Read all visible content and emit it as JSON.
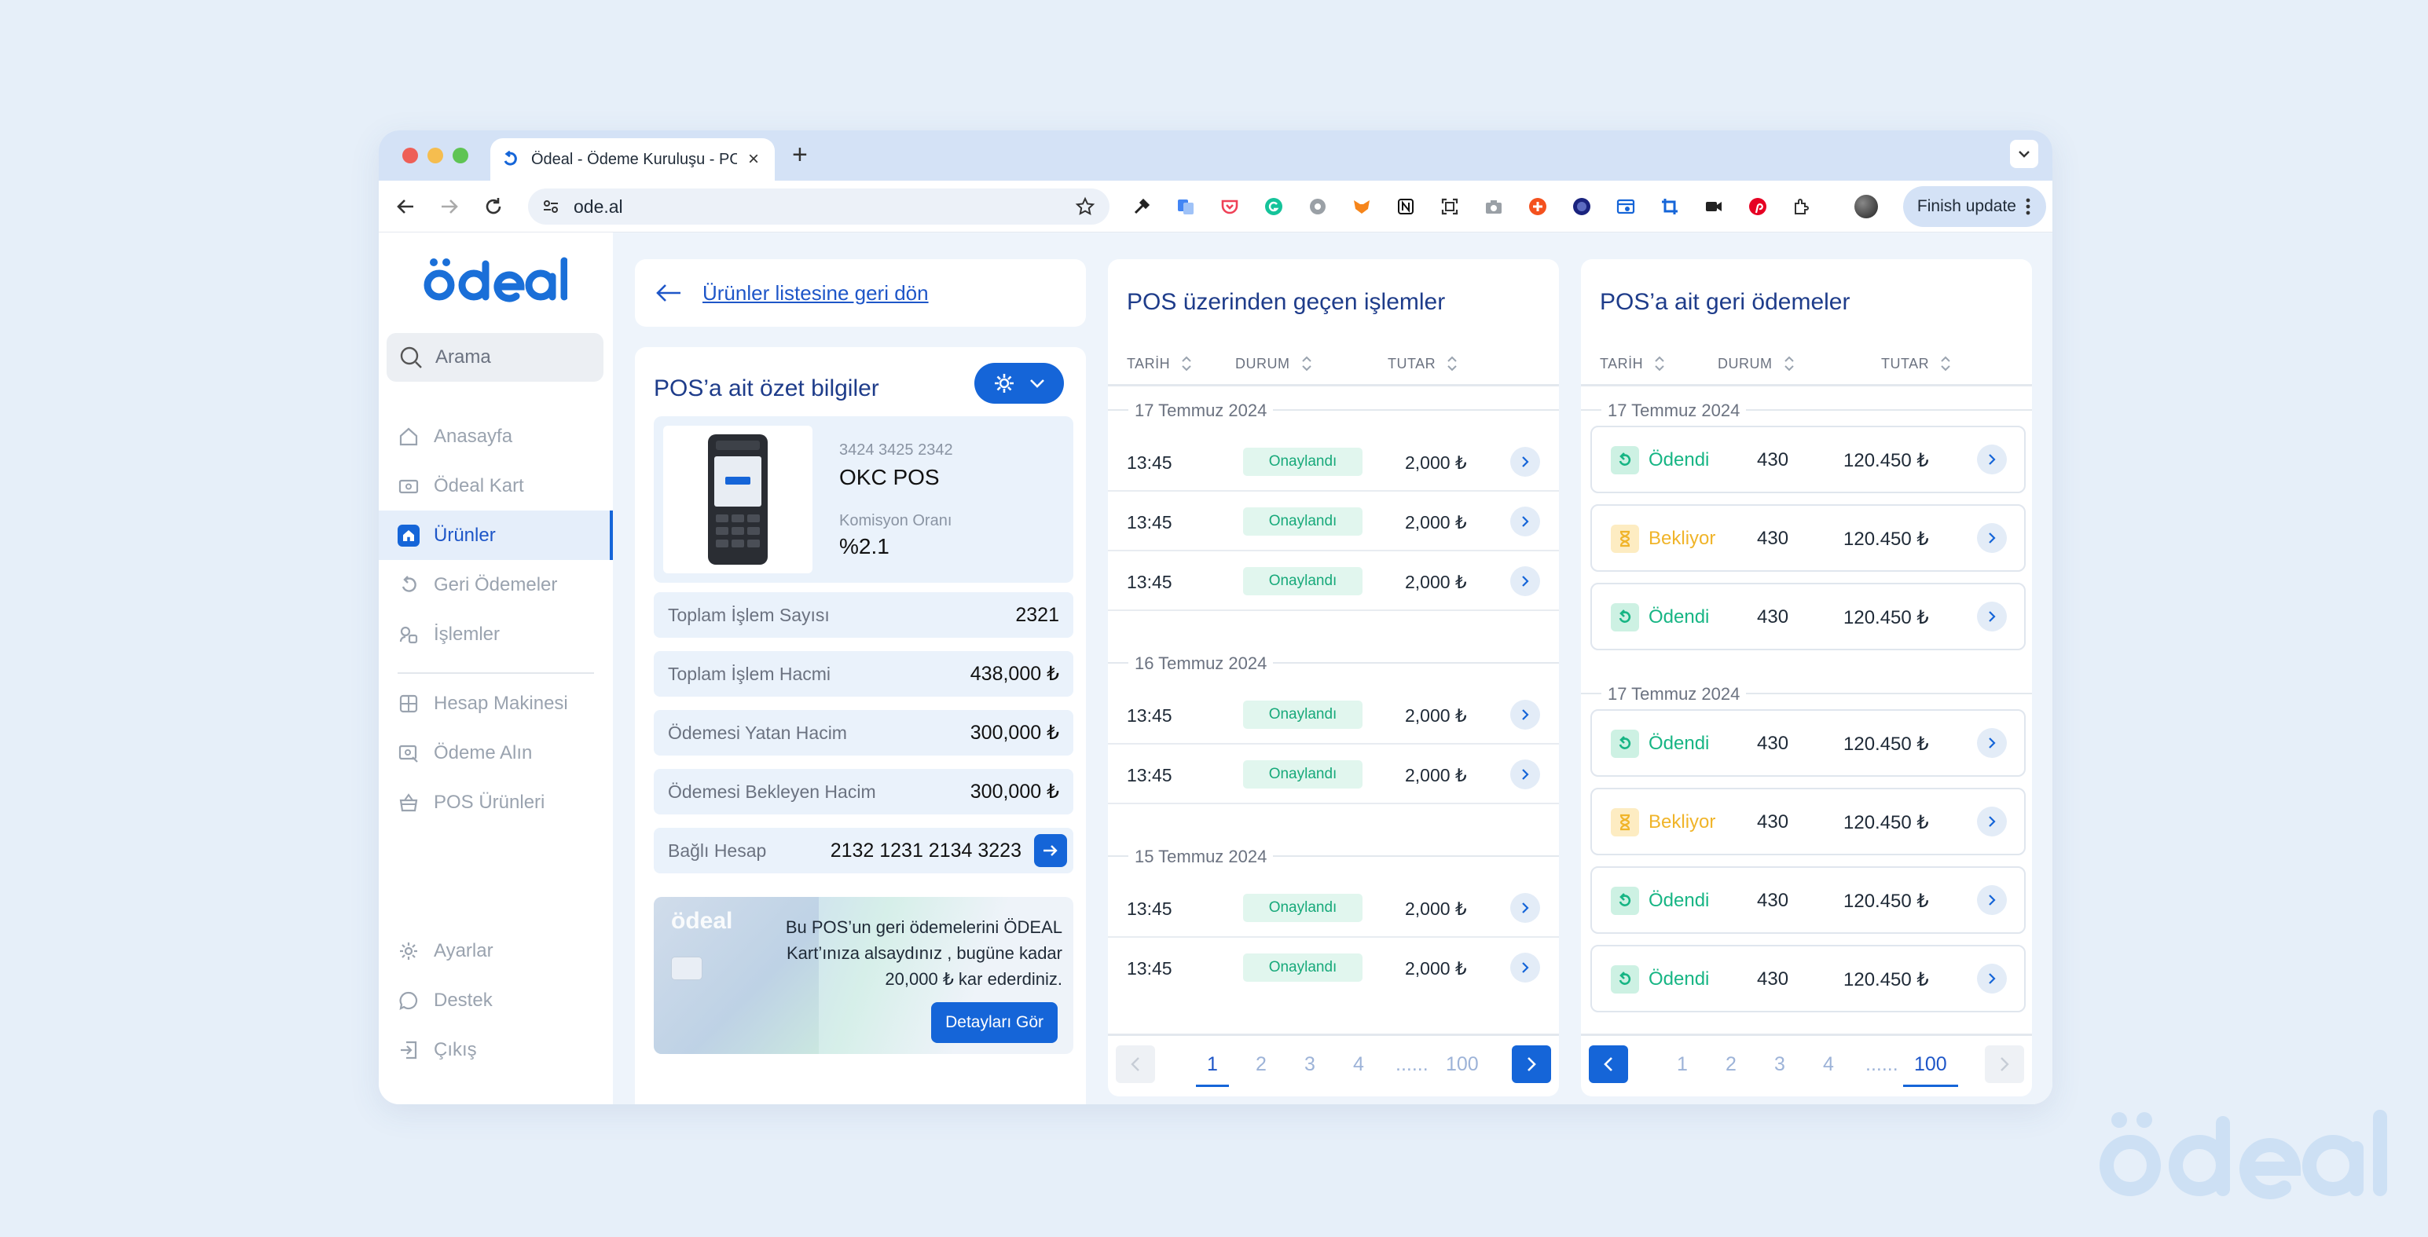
{
  "browser": {
    "tab_title": "Ödeal - Ödeme Kuruluşu - POS",
    "url": "ode.al",
    "finish_update": "Finish update"
  },
  "sidebar": {
    "search_placeholder": "Arama",
    "items": [
      {
        "label": "Anasayfa",
        "icon": "home-icon"
      },
      {
        "label": "Ödeal Kart",
        "icon": "card-icon"
      },
      {
        "label": "Ürünler",
        "icon": "home-filled-icon",
        "active": true
      },
      {
        "label": "Geri Ödemeler",
        "icon": "refund-icon"
      },
      {
        "label": "İşlemler",
        "icon": "transactions-icon"
      },
      {
        "label": "Hesap Makinesi",
        "icon": "calculator-icon"
      },
      {
        "label": "Ödeme Alın",
        "icon": "payment-icon"
      },
      {
        "label": "POS Ürünleri",
        "icon": "basket-icon"
      },
      {
        "label": "Ayarlar",
        "icon": "settings-icon"
      },
      {
        "label": "Destek",
        "icon": "chat-icon"
      },
      {
        "label": "Çıkış",
        "icon": "logout-icon"
      }
    ]
  },
  "back": {
    "label": "Ürünler listesine geri dön"
  },
  "summary": {
    "title": "POS’a ait özet bilgiler",
    "serial": "3424 3425 2342",
    "device_name": "OKC POS",
    "commission_label": "Komisyon Oranı",
    "commission_value": "%2.1",
    "rows": [
      {
        "label": "Toplam İşlem Sayısı",
        "value": "2321"
      },
      {
        "label": "Toplam İşlem Hacmi",
        "value": "438,000 ₺"
      },
      {
        "label": "Ödemesi Yatan Hacim",
        "value": "300,000 ₺"
      },
      {
        "label": "Ödemesi Bekleyen Hacim",
        "value": "300,000 ₺"
      }
    ],
    "linked_label": "Bağlı Hesap",
    "linked_value": "2132 1231 2134 3223",
    "promo_logo": "ödeal",
    "promo_text": "Bu POS’un geri ödemelerini ÖDEAL Kart’ınıza alsaydınız , bugüne kadar 20,000 ₺ kar ederdiniz.",
    "promo_button": "Detayları Gör"
  },
  "transactions": {
    "title": "POS üzerinden geçen işlemler",
    "headers": [
      "TARİH",
      "DURUM",
      "TUTAR"
    ],
    "groups": [
      {
        "date": "17 Temmuz 2024",
        "rows": [
          {
            "time": "13:45",
            "status": "Onaylandı",
            "amount": "2,000 ₺"
          },
          {
            "time": "13:45",
            "status": "Onaylandı",
            "amount": "2,000 ₺"
          },
          {
            "time": "13:45",
            "status": "Onaylandı",
            "amount": "2,000 ₺"
          }
        ]
      },
      {
        "date": "16 Temmuz 2024",
        "rows": [
          {
            "time": "13:45",
            "status": "Onaylandı",
            "amount": "2,000 ₺"
          },
          {
            "time": "13:45",
            "status": "Onaylandı",
            "amount": "2,000 ₺"
          }
        ]
      },
      {
        "date": "15 Temmuz 2024",
        "rows": [
          {
            "time": "13:45",
            "status": "Onaylandı",
            "amount": "2,000 ₺"
          },
          {
            "time": "13:45",
            "status": "Onaylandı",
            "amount": "2,000 ₺"
          }
        ]
      }
    ],
    "pages": [
      "1",
      "2",
      "3",
      "4",
      "......",
      "100"
    ]
  },
  "refunds": {
    "title": "POS’a ait geri ödemeler",
    "headers": [
      "TARİH",
      "DURUM",
      "TUTAR"
    ],
    "groups": [
      {
        "date": "17 Temmuz 2024",
        "rows": [
          {
            "status": "Ödendi",
            "count": "430",
            "amount": "120.450 ₺",
            "kind": "paid"
          },
          {
            "status": "Bekliyor",
            "count": "430",
            "amount": "120.450 ₺",
            "kind": "pending"
          },
          {
            "status": "Ödendi",
            "count": "430",
            "amount": "120.450 ₺",
            "kind": "paid"
          }
        ]
      },
      {
        "date": "17 Temmuz 2024",
        "rows": [
          {
            "status": "Ödendi",
            "count": "430",
            "amount": "120.450 ₺",
            "kind": "paid"
          },
          {
            "status": "Bekliyor",
            "count": "430",
            "amount": "120.450 ₺",
            "kind": "pending"
          },
          {
            "status": "Ödendi",
            "count": "430",
            "amount": "120.450 ₺",
            "kind": "paid"
          },
          {
            "status": "Ödendi",
            "count": "430",
            "amount": "120.450 ₺",
            "kind": "paid"
          }
        ]
      }
    ],
    "pages": [
      "1",
      "2",
      "3",
      "4",
      "......",
      "100"
    ]
  },
  "colors": {
    "primary": "#1565d8",
    "paid": "#17b584",
    "pending": "#f0b429",
    "approved_bg": "#e1f6ee"
  }
}
